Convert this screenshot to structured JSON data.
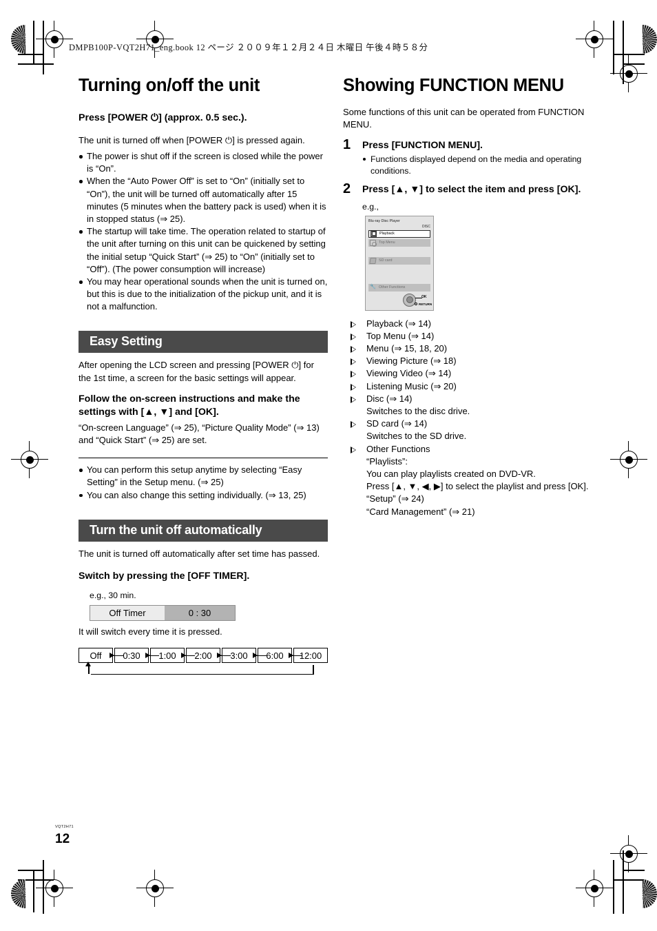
{
  "file_header": "DMPB100P-VQT2H71_eng.book   12 ページ   ２００９年１２月２４日   木曜日   午後４時５８分",
  "footer": {
    "code": "VQT2H71",
    "page_number": "12"
  },
  "left_column": {
    "title": "Turning on/off the unit",
    "heading_press_power": "Press [POWER ⏻] (approx. 0.5 sec.).",
    "intro": "The unit is turned off when [POWER ⏻] is pressed again.",
    "bullets": [
      "The power is shut off if the screen is closed while the power is “On”.",
      "When the “Auto Power Off” is set to “On” (initially set to “On”), the unit will be turned off automatically after 15 minutes (5 minutes when the battery pack is used) when it is in stopped status (⇒ 25).",
      "The startup will take time. The operation related to startup of the unit after turning on this unit can be quickened by setting the initial setup “Quick Start” (⇒ 25) to “On” (initially set to “Off”). (The power consumption will increase)",
      "You may hear operational sounds when the unit is turned on, but this is due to the initialization of the pickup unit, and it is not a malfunction."
    ],
    "easy_setting": {
      "banner": "Easy Setting",
      "intro": "After opening the LCD screen and pressing [POWER ⏻] for the 1st time, a screen for the basic settings will appear.",
      "heading": "Follow the on-screen instructions and make the settings with [▲, ▼] and [OK].",
      "note": "“On-screen Language” (⇒ 25), “Picture Quality Mode” (⇒ 13) and “Quick Start” (⇒ 25) are set.",
      "bullets": [
        "You can perform this setup anytime by selecting “Easy Setting” in the Setup menu. (⇒ 25)",
        "You can also change this setting individually. (⇒ 13, 25)"
      ]
    },
    "auto_off": {
      "banner": "Turn the unit off automatically",
      "intro": "The unit is turned off automatically after set time has passed.",
      "heading": "Switch by pressing the [OFF TIMER].",
      "eg_label": "e.g., 30 min.",
      "off_timer_widget": {
        "label": "Off Timer",
        "value": "0 : 30"
      },
      "switch_note": "It will switch every time it is pressed.",
      "chain": [
        "Off",
        "0:30",
        "1:00",
        "2:00",
        "3:00",
        "6:00",
        "12:00"
      ]
    }
  },
  "right_column": {
    "title": "Showing FUNCTION MENU",
    "intro": "Some functions of this unit can be operated from FUNCTION MENU.",
    "steps": [
      {
        "num": "1",
        "title": "Press [FUNCTION MENU].",
        "bullets": [
          "Functions displayed depend on the media and operating conditions."
        ]
      },
      {
        "num": "2",
        "title": "Press [▲, ▼] to select the item and press [OK].",
        "bullets": []
      }
    ],
    "eg_label": "e.g.,",
    "screen_mock": {
      "title": "Blu-ray Disc Player",
      "disc_label": "DISC",
      "rows": [
        {
          "label": "Playback",
          "icon": "playback-icon",
          "state": "selected"
        },
        {
          "label": "Top Menu",
          "icon": "top-menu-icon",
          "state": "dim"
        },
        {
          "label": "",
          "icon": "",
          "state": "spacer"
        },
        {
          "label": "SD card",
          "icon": "sd-card-icon",
          "state": "dim"
        },
        {
          "label": "",
          "icon": "",
          "state": "spacer"
        },
        {
          "label": "Other Functions",
          "icon": "other-functions-icon",
          "state": "dim"
        }
      ],
      "pad_ok": "OK",
      "pad_return": "RETURN"
    },
    "items": [
      {
        "type": "tri",
        "text": "Playback (⇒ 14)"
      },
      {
        "type": "tri",
        "text": "Top Menu (⇒ 14)"
      },
      {
        "type": "tri",
        "text": "Menu (⇒ 15, 18, 20)"
      },
      {
        "type": "tri",
        "text": "Viewing Picture (⇒ 18)"
      },
      {
        "type": "tri",
        "text": "Viewing Video (⇒ 14)"
      },
      {
        "type": "tri",
        "text": "Listening Music (⇒ 20)"
      },
      {
        "type": "tri",
        "text": "Disc (⇒ 14)"
      },
      {
        "type": "cont",
        "text": "Switches to the disc drive."
      },
      {
        "type": "tri",
        "text": "SD card (⇒ 14)"
      },
      {
        "type": "cont",
        "text": "Switches to the SD drive."
      },
      {
        "type": "tri",
        "text": "Other Functions"
      },
      {
        "type": "cont",
        "text": "“Playlists”:"
      },
      {
        "type": "cont",
        "text": "You can play playlists created on DVD-VR."
      },
      {
        "type": "cont",
        "text": "Press [▲, ▼, ◀, ▶] to select the playlist and press [OK]."
      },
      {
        "type": "cont",
        "text": "“Setup” (⇒ 24)"
      },
      {
        "type": "cont",
        "text": "“Card Management” (⇒ 21)"
      }
    ]
  }
}
